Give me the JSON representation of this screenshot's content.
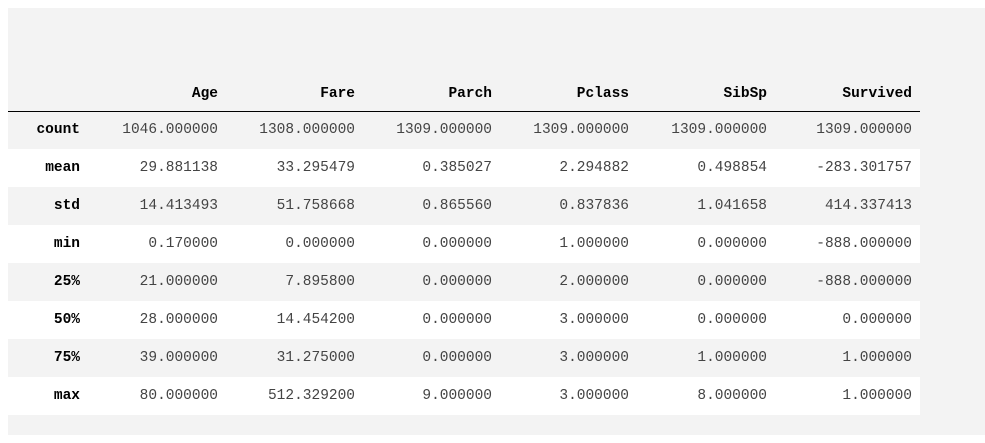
{
  "table": {
    "columns": [
      "Age",
      "Fare",
      "Parch",
      "Pclass",
      "SibSp",
      "Survived"
    ],
    "rows": [
      {
        "index": "count",
        "values": [
          "1046.000000",
          "1308.000000",
          "1309.000000",
          "1309.000000",
          "1309.000000",
          "1309.000000"
        ]
      },
      {
        "index": "mean",
        "values": [
          "29.881138",
          "33.295479",
          "0.385027",
          "2.294882",
          "0.498854",
          "-283.301757"
        ]
      },
      {
        "index": "std",
        "values": [
          "14.413493",
          "51.758668",
          "0.865560",
          "0.837836",
          "1.041658",
          "414.337413"
        ]
      },
      {
        "index": "min",
        "values": [
          "0.170000",
          "0.000000",
          "0.000000",
          "1.000000",
          "0.000000",
          "-888.000000"
        ]
      },
      {
        "index": "25%",
        "values": [
          "21.000000",
          "7.895800",
          "0.000000",
          "2.000000",
          "0.000000",
          "-888.000000"
        ]
      },
      {
        "index": "50%",
        "values": [
          "28.000000",
          "14.454200",
          "0.000000",
          "3.000000",
          "0.000000",
          "0.000000"
        ]
      },
      {
        "index": "75%",
        "values": [
          "39.000000",
          "31.275000",
          "0.000000",
          "3.000000",
          "1.000000",
          "1.000000"
        ]
      },
      {
        "index": "max",
        "values": [
          "80.000000",
          "512.329200",
          "9.000000",
          "3.000000",
          "8.000000",
          "1.000000"
        ]
      }
    ]
  }
}
